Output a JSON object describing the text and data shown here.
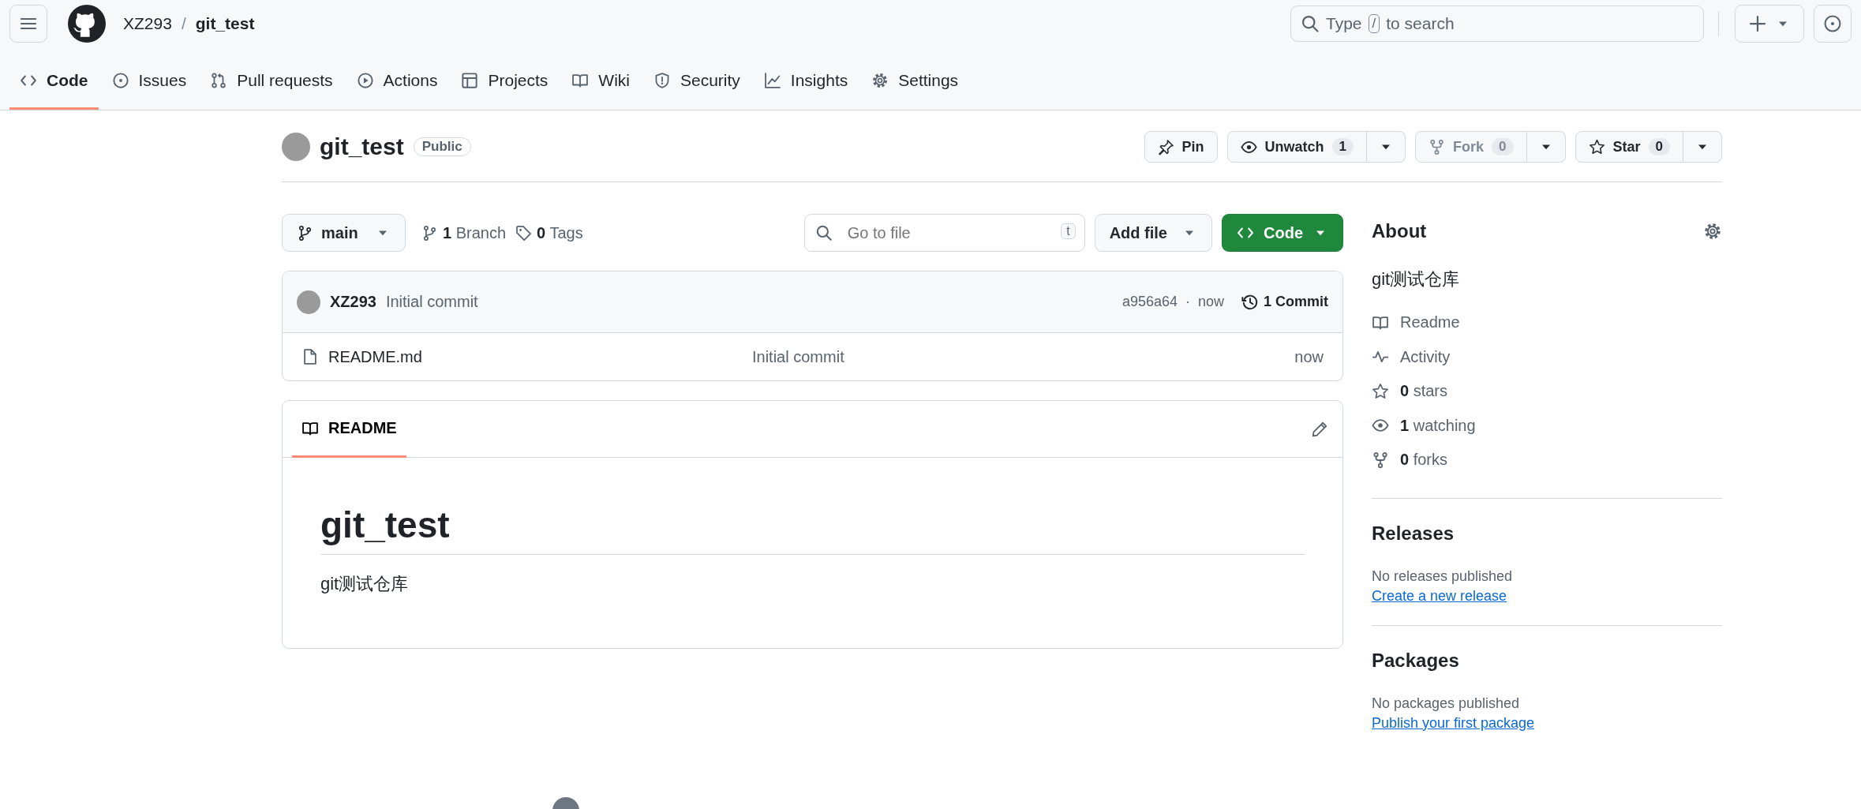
{
  "topbar": {
    "owner": "XZ293",
    "separator": "/",
    "repo": "git_test",
    "search": {
      "hint_start": "Type",
      "key": "/",
      "hint_end": "to search"
    }
  },
  "tabs": [
    {
      "label": "Code",
      "selected": true
    },
    {
      "label": "Issues",
      "selected": false
    },
    {
      "label": "Pull requests",
      "selected": false
    },
    {
      "label": "Actions",
      "selected": false
    },
    {
      "label": "Projects",
      "selected": false
    },
    {
      "label": "Wiki",
      "selected": false
    },
    {
      "label": "Security",
      "selected": false
    },
    {
      "label": "Insights",
      "selected": false
    },
    {
      "label": "Settings",
      "selected": false
    }
  ],
  "repo": {
    "name": "git_test",
    "visibility": "Public",
    "actions": [
      {
        "label": "Pin",
        "disabled": false
      },
      {
        "label": "Unwatch",
        "count": "1",
        "disabled": false
      },
      {
        "label": "Fork",
        "count": "0",
        "disabled": true
      },
      {
        "label": "Star",
        "count": "0",
        "disabled": false
      }
    ]
  },
  "file_bar": {
    "branch": "main",
    "branches": "**1** Branch",
    "tags": "**0** Tags",
    "go_to_file": {
      "placeholder": "Go to file",
      "shortcut": "t"
    },
    "add_file": "Add file",
    "code": "Code"
  },
  "latest_commit": {
    "author": "XZ293",
    "message": "Initial commit",
    "hash": "a956a64",
    "separator": "·",
    "time": "now",
    "commits": "1 Commit"
  },
  "files": [
    {
      "name": "README.md",
      "message": "Initial commit",
      "time": "now"
    }
  ],
  "readme": {
    "tab": "README",
    "title": "git_test",
    "body": "git测试仓库"
  },
  "about": {
    "title": "About",
    "description": "git测试仓库",
    "links": [
      {
        "label": "Readme"
      },
      {
        "label": "Activity"
      },
      {
        "label": "**0** stars"
      },
      {
        "label": "**1** watching"
      },
      {
        "label": "**0** forks"
      }
    ]
  },
  "releases": {
    "title": "Releases",
    "note": "No releases published",
    "link": "Create a new release"
  },
  "packages": {
    "title": "Packages",
    "note": "No packages published",
    "link": "Publish your first package"
  }
}
